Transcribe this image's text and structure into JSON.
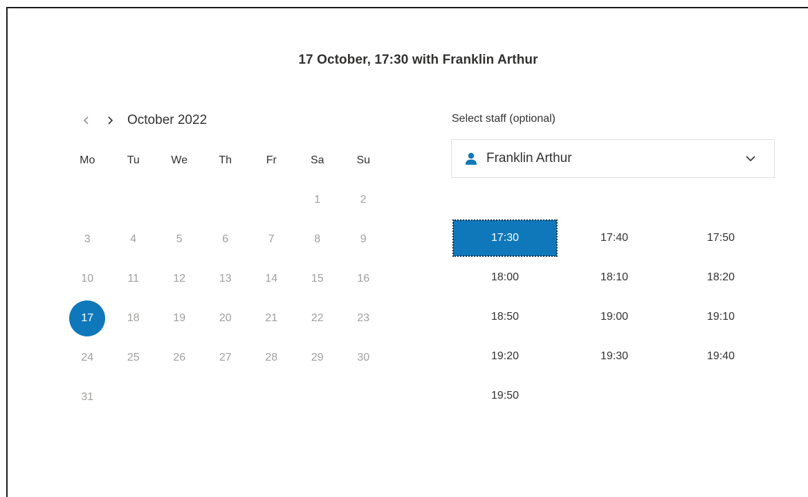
{
  "header": {
    "title": "17 October, 17:30 with Franklin Arthur"
  },
  "calendar": {
    "month_label": "October 2022",
    "weekdays": [
      "Mo",
      "Tu",
      "We",
      "Th",
      "Fr",
      "Sa",
      "Su"
    ],
    "weeks": [
      [
        "",
        "",
        "",
        "",
        "",
        "1",
        "2"
      ],
      [
        "3",
        "4",
        "5",
        "6",
        "7",
        "8",
        "9"
      ],
      [
        "10",
        "11",
        "12",
        "13",
        "14",
        "15",
        "16"
      ],
      [
        "17",
        "18",
        "19",
        "20",
        "21",
        "22",
        "23"
      ],
      [
        "24",
        "25",
        "26",
        "27",
        "28",
        "29",
        "30"
      ],
      [
        "31",
        "",
        "",
        "",
        "",
        "",
        ""
      ]
    ],
    "selected_day": "17"
  },
  "staff": {
    "label": "Select staff (optional)",
    "selected": "Franklin Arthur"
  },
  "time_slots": {
    "rows": [
      [
        "17:30",
        "17:40",
        "17:50"
      ],
      [
        "18:00",
        "18:10",
        "18:20"
      ],
      [
        "18:50",
        "19:00",
        "19:10"
      ],
      [
        "19:20",
        "19:30",
        "19:40"
      ],
      [
        "19:50"
      ]
    ],
    "selected": "17:30"
  },
  "colors": {
    "accent": "#0f78bb",
    "text": "#323130",
    "muted": "#a19f9d",
    "border": "#e1dfdd"
  }
}
